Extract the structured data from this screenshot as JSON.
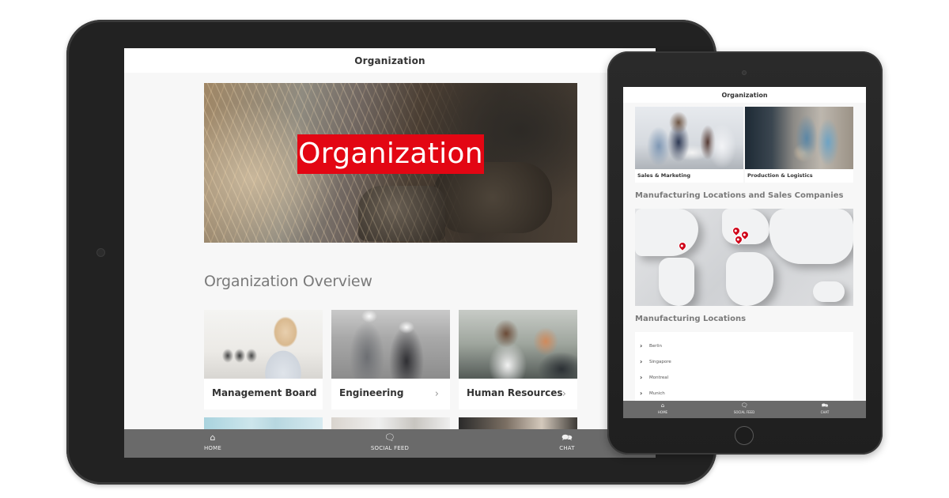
{
  "large_tablet": {
    "header": {
      "title": "Organization"
    },
    "hero": {
      "label": "Organization"
    },
    "overview": {
      "title": "Organization Overview",
      "cards": [
        {
          "label": "Management Board"
        },
        {
          "label": "Engineering"
        },
        {
          "label": "Human Resources"
        }
      ]
    },
    "nav": [
      {
        "label": "HOME",
        "icon": "home-icon",
        "glyph": "⌂"
      },
      {
        "label": "SOCIAL FEED",
        "icon": "speech-bubble-icon",
        "glyph": "🗨"
      },
      {
        "label": "CHAT",
        "icon": "chat-bubbles-icon",
        "glyph": "🗪"
      }
    ]
  },
  "small_tablet": {
    "header": {
      "title": "Organization"
    },
    "cards": [
      {
        "label": "Sales & Marketing"
      },
      {
        "label": "Production & Logistics"
      }
    ],
    "map_section": {
      "title": "Manufacturing Locations and Sales Companies"
    },
    "locations_section": {
      "title": "Manufacturing Locations",
      "items": [
        "Berlin",
        "Singapore",
        "Montreal",
        "Munich"
      ]
    },
    "nav": [
      {
        "label": "HOME",
        "icon": "home-icon",
        "glyph": "⌂"
      },
      {
        "label": "SOCIAL FEED",
        "icon": "speech-bubble-icon",
        "glyph": "🗨"
      },
      {
        "label": "CHAT",
        "icon": "chat-bubbles-icon",
        "glyph": "🗪"
      }
    ]
  },
  "colors": {
    "accent": "#e30613",
    "nav_bar": "#6a6a6a",
    "device_frame": "#222222",
    "map_pin": "#d0061a"
  }
}
